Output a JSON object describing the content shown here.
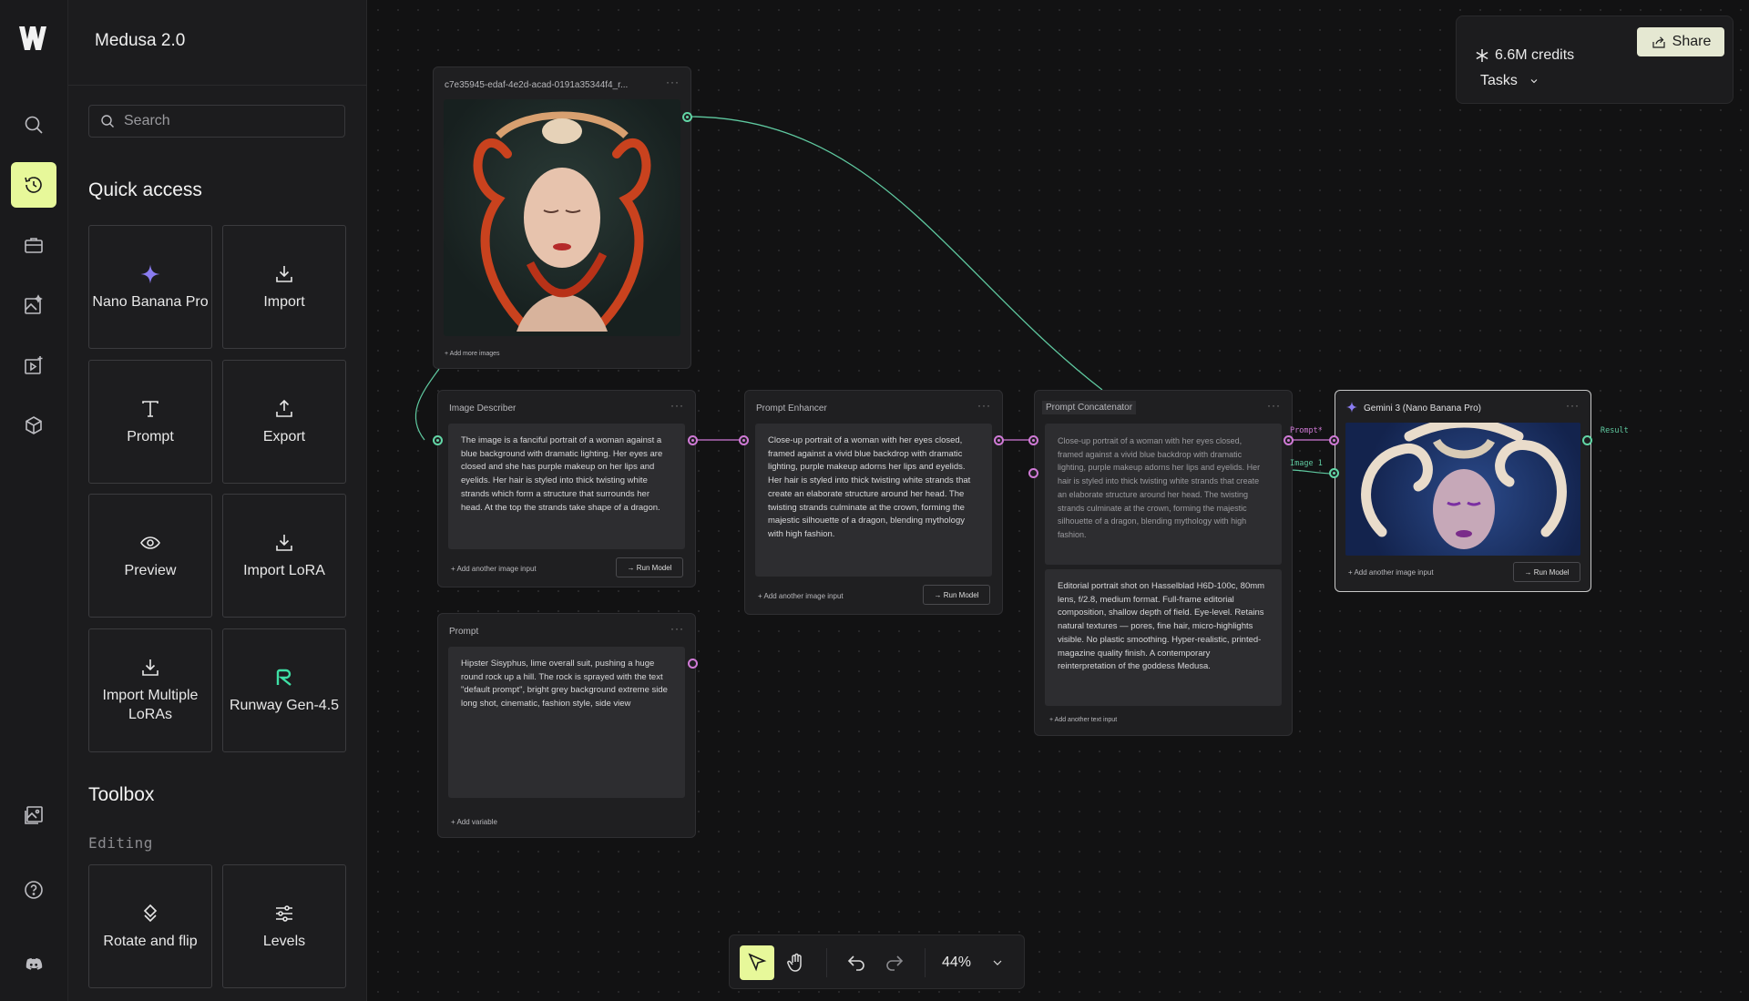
{
  "app": {
    "title": "Medusa 2.0"
  },
  "search": {
    "placeholder": "Search"
  },
  "rail": {
    "icons": [
      "logo-icon",
      "search-icon",
      "history-icon",
      "briefcase-icon",
      "image-edit-icon",
      "video-add-icon",
      "cube-add-icon",
      "gallery-icon",
      "help-icon",
      "discord-icon"
    ]
  },
  "quick_access": {
    "heading": "Quick access",
    "items": [
      {
        "label": "Nano Banana Pro",
        "icon": "sparkle-icon"
      },
      {
        "label": "Import",
        "icon": "download-icon"
      },
      {
        "label": "Prompt",
        "icon": "text-icon"
      },
      {
        "label": "Export",
        "icon": "upload-icon"
      },
      {
        "label": "Preview",
        "icon": "eye-icon"
      },
      {
        "label": "Import LoRA",
        "icon": "download-icon"
      },
      {
        "label": "Import Multiple LoRAs",
        "icon": "download-icon"
      },
      {
        "label": "Runway Gen-4.5",
        "icon": "runway-icon"
      }
    ]
  },
  "toolbox": {
    "heading": "Toolbox",
    "section": "Editing",
    "items": [
      {
        "label": "Rotate and flip",
        "icon": "rotate-icon"
      },
      {
        "label": "Levels",
        "icon": "sliders-icon"
      }
    ]
  },
  "top_right": {
    "credits": "6.6M credits",
    "share": "Share",
    "tasks": "Tasks"
  },
  "toolbar": {
    "zoom": "44%"
  },
  "colors": {
    "accent": "#e7f89a",
    "port_pink": "#d07ad6",
    "port_green": "#62d6a6"
  },
  "nodes": {
    "image_input": {
      "title": "c7e35945-edaf-4e2d-acad-0191a35344f4_r...",
      "footer": "+ Add more images"
    },
    "describer": {
      "title": "Image Describer",
      "text": "The image is a fanciful portrait of a woman against a blue background with dramatic lighting. Her eyes are closed and she has purple makeup on her lips and eyelids. Her hair is styled into thick twisting white strands which form a structure that surrounds her head. At the top the strands take shape of a dragon.",
      "footer": "Add another image input",
      "run": "Run Model"
    },
    "enhancer": {
      "title": "Prompt Enhancer",
      "text": "Close-up portrait of a woman with her eyes closed, framed against a vivid blue backdrop with dramatic lighting, purple makeup adorns her lips and eyelids. Her hair is styled into thick twisting white strands that create an elaborate structure around her head. The twisting strands culminate at the crown, forming the majestic silhouette of a dragon, blending mythology with high fashion.",
      "footer": "Add another image input",
      "run": "Run Model"
    },
    "concatenator": {
      "title": "Prompt Concatenator",
      "text1": "Close-up portrait of a woman with her eyes closed, framed against a vivid blue backdrop with dramatic lighting, purple makeup adorns her lips and eyelids. Her hair is styled into thick twisting white strands that create an elaborate structure around her head. The twisting strands culminate at the crown, forming the majestic silhouette of a dragon, blending mythology with high fashion.",
      "text2": "Editorial portrait shot on Hasselblad H6D-100c, 80mm lens, f/2.8, medium format. Full-frame editorial composition, shallow depth of field. Eye-level. Retains natural textures — pores, fine hair, micro-highlights visible. No plastic smoothing. Hyper-realistic, printed-magazine quality finish. A contemporary reinterpretation of the goddess Medusa.",
      "footer": "+ Add another text input"
    },
    "prompt": {
      "title": "Prompt",
      "text": "Hipster Sisyphus, lime overall suit, pushing a huge round rock up a hill. The rock is sprayed with the text \"default prompt\", bright grey background extreme side long shot, cinematic, fashion style, side view",
      "footer": "Add variable"
    },
    "gemini": {
      "title": "Gemini 3 (Nano Banana Pro)",
      "footer": "Add another image input",
      "run": "Run Model",
      "input_labels": [
        "Prompt*",
        "Image 1"
      ],
      "output_label": "Result"
    }
  }
}
